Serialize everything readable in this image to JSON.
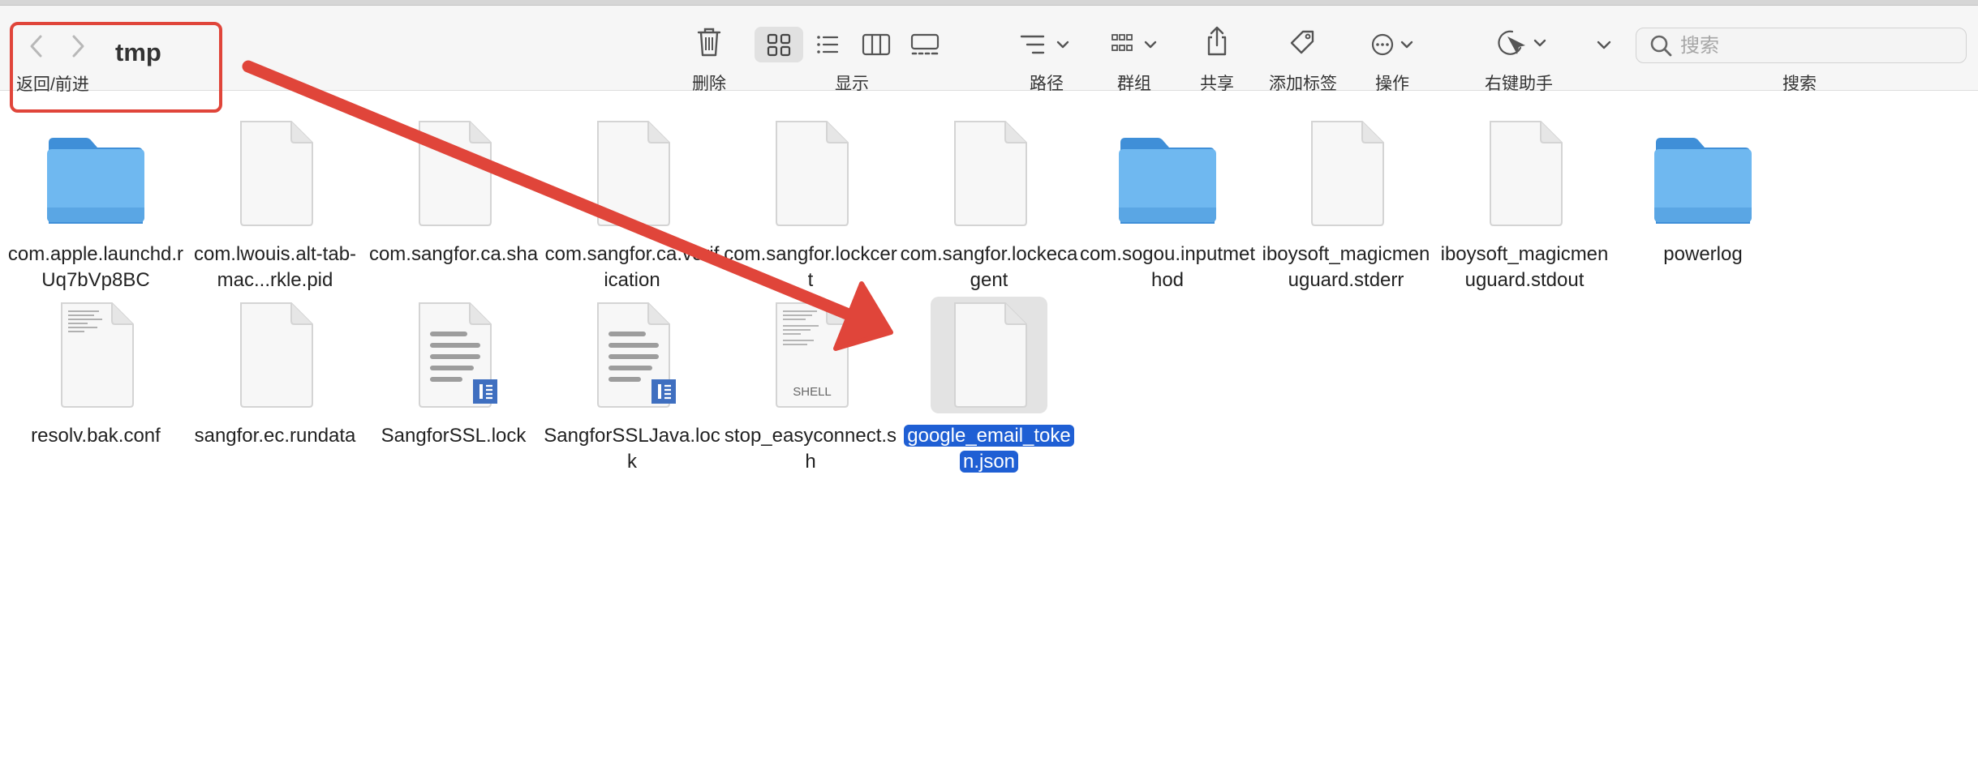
{
  "window": {
    "title": "tmp",
    "nav_label": "返回/前进"
  },
  "toolbar": {
    "delete_label": "删除",
    "view_label": "显示",
    "path_label": "路径",
    "group_label": "群组",
    "share_label": "共享",
    "tags_label": "添加标签",
    "action_label": "操作",
    "helper_label": "右键助手",
    "search_label": "搜索",
    "search_placeholder": "搜索",
    "search_value": ""
  },
  "files": [
    {
      "name": "com.apple.launchd.rUq7bVp8BC",
      "icon": "folder-icon",
      "selected": false
    },
    {
      "name": "com.lwouis.alt-tab-mac...rkle.pid",
      "icon": "document-icon",
      "selected": false
    },
    {
      "name": "com.sangfor.ca.sha",
      "icon": "document-icon",
      "selected": false
    },
    {
      "name": "com.sangfor.ca.verification",
      "icon": "document-icon",
      "selected": false
    },
    {
      "name": "com.sangfor.lockcert",
      "icon": "document-icon",
      "selected": false
    },
    {
      "name": "com.sangfor.lockecagent",
      "icon": "document-icon",
      "selected": false
    },
    {
      "name": "com.sogou.inputmethod",
      "icon": "folder-icon",
      "selected": false
    },
    {
      "name": "iboysoft_magicmenuguard.stderr",
      "icon": "document-icon",
      "selected": false
    },
    {
      "name": "iboysoft_magicmenuguard.stdout",
      "icon": "document-icon",
      "selected": false
    },
    {
      "name": "powerlog",
      "icon": "folder-icon",
      "selected": false
    },
    {
      "name": "resolv.bak.conf",
      "icon": "text-document-icon",
      "selected": false
    },
    {
      "name": "sangfor.ec.rundata",
      "icon": "document-icon",
      "selected": false
    },
    {
      "name": "SangforSSL.lock",
      "icon": "lock-document-icon",
      "selected": false
    },
    {
      "name": "SangforSSLJava.lock",
      "icon": "lock-document-icon",
      "selected": false
    },
    {
      "name": "stop_easyconnect.sh",
      "icon": "shell-script-icon",
      "selected": false,
      "badge": "SHELL"
    },
    {
      "name": "google_email_token.json",
      "icon": "document-icon",
      "selected": true
    }
  ],
  "colors": {
    "accent": "#1f5fd4",
    "annotation": "#e0453a",
    "folder": "#6fb8f0"
  }
}
